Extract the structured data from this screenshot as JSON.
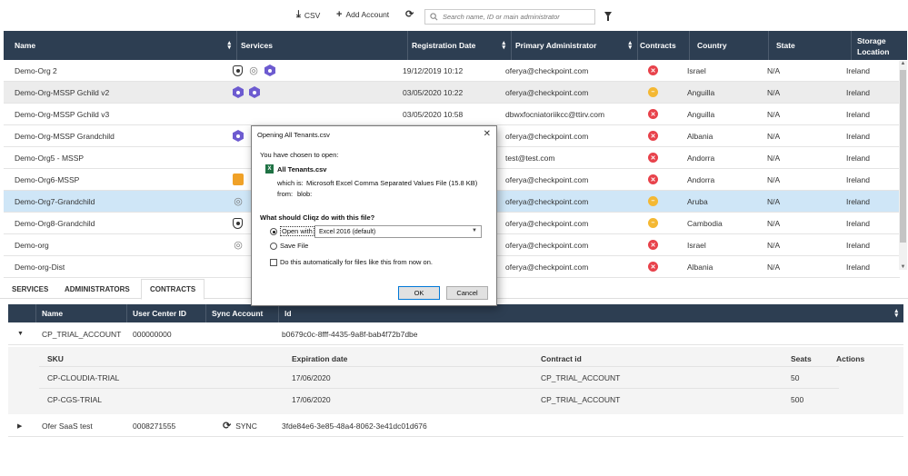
{
  "toolbar": {
    "csv_label": "CSV",
    "add_account_label": "Add Account",
    "search_placeholder": "Search name, ID or main administrator"
  },
  "table": {
    "columns": {
      "name": "Name",
      "services": "Services",
      "registration_date": "Registration Date",
      "primary_admin": "Primary Administrator",
      "contracts": "Contracts",
      "country": "Country",
      "state": "State",
      "storage_location_1": "Storage",
      "storage_location_2": "Location"
    },
    "rows": [
      {
        "name": "Demo-Org 2",
        "services": [
          "shield",
          "finger",
          "hex-purple"
        ],
        "date": "19/12/2019 10:12",
        "admin": "oferya@checkpoint.com",
        "contract": "red",
        "country": "Israel",
        "state": "N/A",
        "storage": "Ireland",
        "style": "plain"
      },
      {
        "name": "Demo-Org-MSSP Gchild v2",
        "services": [
          "hex-purple",
          "hex-purple"
        ],
        "date": "03/05/2020 10:22",
        "admin": "oferya@checkpoint.com",
        "contract": "yellow",
        "country": "Anguilla",
        "state": "N/A",
        "storage": "Ireland",
        "style": "gray"
      },
      {
        "name": "Demo-Org-MSSP Gchild v3",
        "services": [],
        "date": "03/05/2020 10:58",
        "admin": "dbwxfocniatoriikcc@ttirv.com",
        "contract": "red",
        "country": "Anguilla",
        "state": "N/A",
        "storage": "Ireland",
        "style": "plain"
      },
      {
        "name": "Demo-Org-MSSP Grandchild",
        "services": [
          "hex-purple"
        ],
        "date": "",
        "admin": "oferya@checkpoint.com",
        "contract": "red",
        "country": "Albania",
        "state": "N/A",
        "storage": "Ireland",
        "style": "plain"
      },
      {
        "name": "Demo-Org5 - MSSP",
        "services": [],
        "date": "",
        "admin": "test@test.com",
        "contract": "red",
        "country": "Andorra",
        "state": "N/A",
        "storage": "Ireland",
        "style": "plain"
      },
      {
        "name": "Demo-Org6-MSSP",
        "services": [
          "hex-orange"
        ],
        "date": "",
        "admin": "oferya@checkpoint.com",
        "contract": "red",
        "country": "Andorra",
        "state": "N/A",
        "storage": "Ireland",
        "style": "plain"
      },
      {
        "name": "Demo-Org7-Grandchild",
        "services": [
          "finger"
        ],
        "date": "",
        "admin": "oferya@checkpoint.com",
        "contract": "yellow",
        "country": "Aruba",
        "state": "N/A",
        "storage": "Ireland",
        "style": "sel"
      },
      {
        "name": "Demo-Org8-Grandchild",
        "services": [
          "shield"
        ],
        "date": "",
        "admin": "oferya@checkpoint.com",
        "contract": "yellow",
        "country": "Cambodia",
        "state": "N/A",
        "storage": "Ireland",
        "style": "plain"
      },
      {
        "name": "Demo-org",
        "services": [
          "finger"
        ],
        "date": "",
        "admin": "oferya@checkpoint.com",
        "contract": "red",
        "country": "Israel",
        "state": "N/A",
        "storage": "Ireland",
        "style": "plain"
      },
      {
        "name": "Demo-org-Dist",
        "services": [],
        "date": "",
        "admin": "oferya@checkpoint.com",
        "contract": "red",
        "country": "Albania",
        "state": "N/A",
        "storage": "Ireland",
        "style": "plain"
      }
    ]
  },
  "tabs": [
    "SERVICES",
    "ADMINISTRATORS",
    "CONTRACTS"
  ],
  "contracts": {
    "columns": {
      "name": "Name",
      "user_center_id": "User Center ID",
      "sync_account": "Sync Account",
      "id": "Id"
    },
    "rows": [
      {
        "name": "CP_TRIAL_ACCOUNT",
        "ucid": "000000000",
        "sync": "",
        "id": "b0679c0c-8fff-4435-9a8f-bab4f72b7dbe"
      },
      {
        "name": "Ofer SaaS test",
        "ucid": "0008271555",
        "sync": "SYNC",
        "id": "3fde84e6-3e85-48a4-8062-3e41dc01d676"
      }
    ],
    "sub_columns": {
      "sku": "SKU",
      "expiration": "Expiration date",
      "contract_id": "Contract id",
      "seats": "Seats",
      "actions": "Actions"
    },
    "sub_rows": [
      {
        "sku": "CP-CLOUDIA-TRIAL",
        "expiration": "17/06/2020",
        "contract_id": "CP_TRIAL_ACCOUNT",
        "seats": "50"
      },
      {
        "sku": "CP-CGS-TRIAL",
        "expiration": "17/06/2020",
        "contract_id": "CP_TRIAL_ACCOUNT",
        "seats": "500"
      }
    ]
  },
  "dialog": {
    "title": "Opening All Tenants.csv",
    "chosen_text": "You have chosen to open:",
    "file_name": "All Tenants.csv",
    "which_is_label": "which is:",
    "which_is_value": "Microsoft Excel Comma Separated Values File (15.8 KB)",
    "from_label": "from:",
    "from_value": "blob:",
    "question": "What should Cliqz do with this file?",
    "open_with_label": "Open with",
    "open_with_value": "Excel 2016 (default)",
    "save_file_label": "Save File",
    "auto_label": "Do this automatically for files like this from now on.",
    "ok_label": "OK",
    "cancel_label": "Cancel"
  }
}
